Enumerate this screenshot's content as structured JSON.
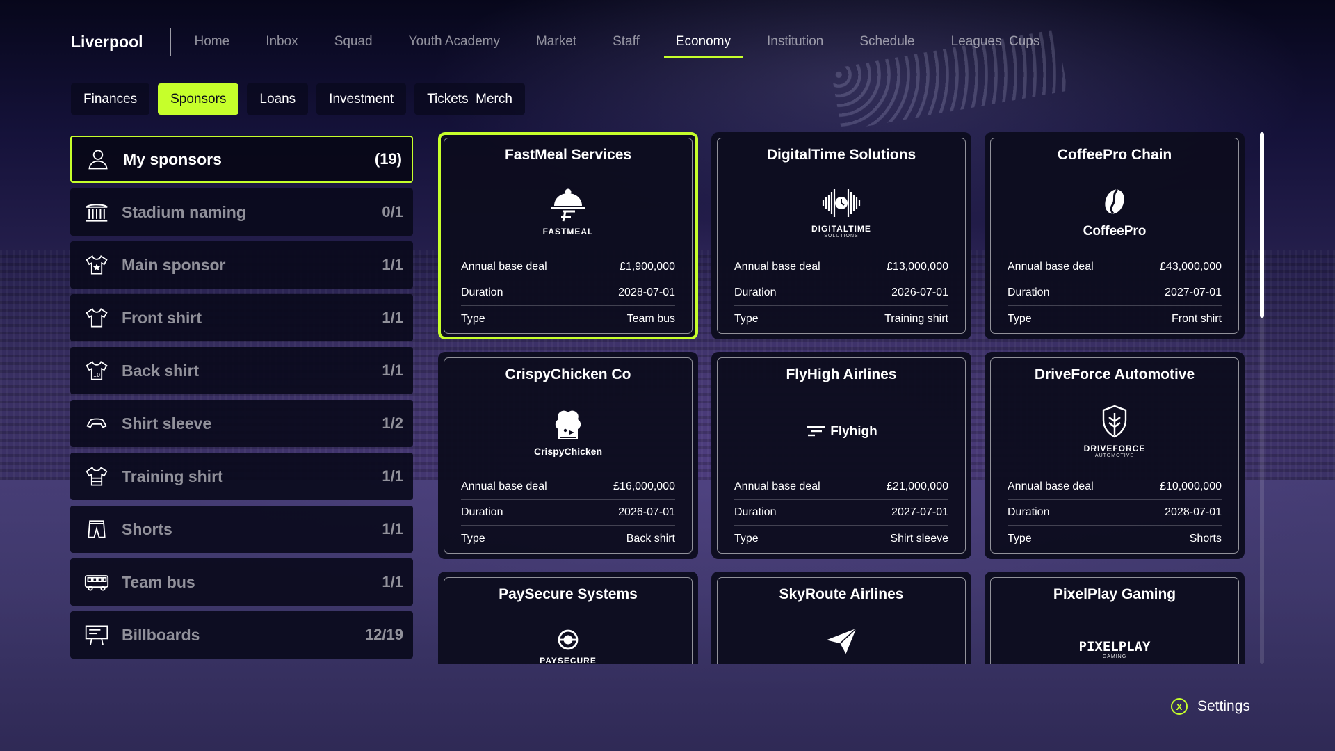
{
  "club_name": "Liverpool",
  "nav": [
    {
      "label": "Home",
      "active": false
    },
    {
      "label": "Inbox",
      "active": false
    },
    {
      "label": "Squad",
      "active": false
    },
    {
      "label": "Youth Academy",
      "active": false
    },
    {
      "label": "Market",
      "active": false
    },
    {
      "label": "Staff",
      "active": false
    },
    {
      "label": "Economy",
      "active": true
    },
    {
      "label": "Institution",
      "active": false
    },
    {
      "label": "Schedule",
      "active": false
    },
    {
      "label": "Leagues  Cups",
      "active": false
    }
  ],
  "subtabs": [
    {
      "label": "Finances",
      "active": false
    },
    {
      "label": "Sponsors",
      "active": true
    },
    {
      "label": "Loans",
      "active": false
    },
    {
      "label": "Investment",
      "active": false
    },
    {
      "label": "Tickets  Merch",
      "active": false
    }
  ],
  "categories": [
    {
      "label": "My sponsors",
      "count": "(19)",
      "icon": "person-icon",
      "active": true
    },
    {
      "label": "Stadium naming",
      "count": "0/1",
      "icon": "stadium-icon",
      "active": false
    },
    {
      "label": "Main sponsor",
      "count": "1/1",
      "icon": "star-shirt-icon",
      "active": false
    },
    {
      "label": "Front shirt",
      "count": "1/1",
      "icon": "shirt-front-icon",
      "active": false
    },
    {
      "label": "Back shirt",
      "count": "1/1",
      "icon": "shirt-back-icon",
      "active": false
    },
    {
      "label": "Shirt sleeve",
      "count": "1/2",
      "icon": "shirt-sleeve-icon",
      "active": false
    },
    {
      "label": "Training shirt",
      "count": "1/1",
      "icon": "training-shirt-icon",
      "active": false
    },
    {
      "label": "Shorts",
      "count": "1/1",
      "icon": "shorts-icon",
      "active": false
    },
    {
      "label": "Team bus",
      "count": "1/1",
      "icon": "bus-icon",
      "active": false
    },
    {
      "label": "Billboards",
      "count": "12/19",
      "icon": "billboard-icon",
      "active": false
    }
  ],
  "field_labels": {
    "annual": "Annual base deal",
    "duration": "Duration",
    "type": "Type"
  },
  "sponsors": [
    {
      "name": "FastMeal Services",
      "logo_text": "FASTMEAL",
      "logo_sub": "",
      "logo_icon": "cloche-icon",
      "annual": "£1,900,000",
      "duration": "2028-07-01",
      "type": "Team bus",
      "selected": true
    },
    {
      "name": "DigitalTime Solutions",
      "logo_text": "DIGITALTIME",
      "logo_sub": "SOLUTIONS",
      "logo_icon": "soundwave-clock-icon",
      "annual": "£13,000,000",
      "duration": "2026-07-01",
      "type": "Training shirt",
      "selected": false
    },
    {
      "name": "CoffeePro Chain",
      "logo_text": "CoffeePro",
      "logo_sub": "",
      "logo_icon": "coffee-bean-icon",
      "annual": "£43,000,000",
      "duration": "2027-07-01",
      "type": "Front shirt",
      "selected": false
    },
    {
      "name": "CrispyChicken Co",
      "logo_text": "CrispyChicken",
      "logo_sub": "",
      "logo_icon": "chicken-chef-icon",
      "annual": "£16,000,000",
      "duration": "2026-07-01",
      "type": "Back shirt",
      "selected": false
    },
    {
      "name": "FlyHigh Airlines",
      "logo_text": "Flyhigh",
      "logo_sub": "",
      "logo_icon": "speed-lines-icon",
      "annual": "£21,000,000",
      "duration": "2027-07-01",
      "type": "Shirt sleeve",
      "selected": false
    },
    {
      "name": "DriveForce Automotive",
      "logo_text": "DRIVEFORCE",
      "logo_sub": "AUTOMOTIVE",
      "logo_icon": "shield-icon",
      "annual": "£10,000,000",
      "duration": "2028-07-01",
      "type": "Shorts",
      "selected": false
    },
    {
      "name": "PaySecure Systems",
      "logo_text": "PAYSECURE",
      "logo_sub": "",
      "logo_icon": "target-icon",
      "annual": "",
      "duration": "",
      "type": "",
      "selected": false
    },
    {
      "name": "SkyRoute Airlines",
      "logo_text": "",
      "logo_sub": "",
      "logo_icon": "paper-plane-icon",
      "annual": "",
      "duration": "",
      "type": "",
      "selected": false
    },
    {
      "name": "PixelPlay Gaming",
      "logo_text": "PIXELPLAY",
      "logo_sub": "GAMING",
      "logo_icon": "pixel-logo-icon",
      "annual": "",
      "duration": "",
      "type": "",
      "selected": false
    }
  ],
  "footer": {
    "button": "X",
    "label": "Settings"
  },
  "colors": {
    "accent": "#c6ff2b",
    "panel": "#0c0c1e"
  }
}
